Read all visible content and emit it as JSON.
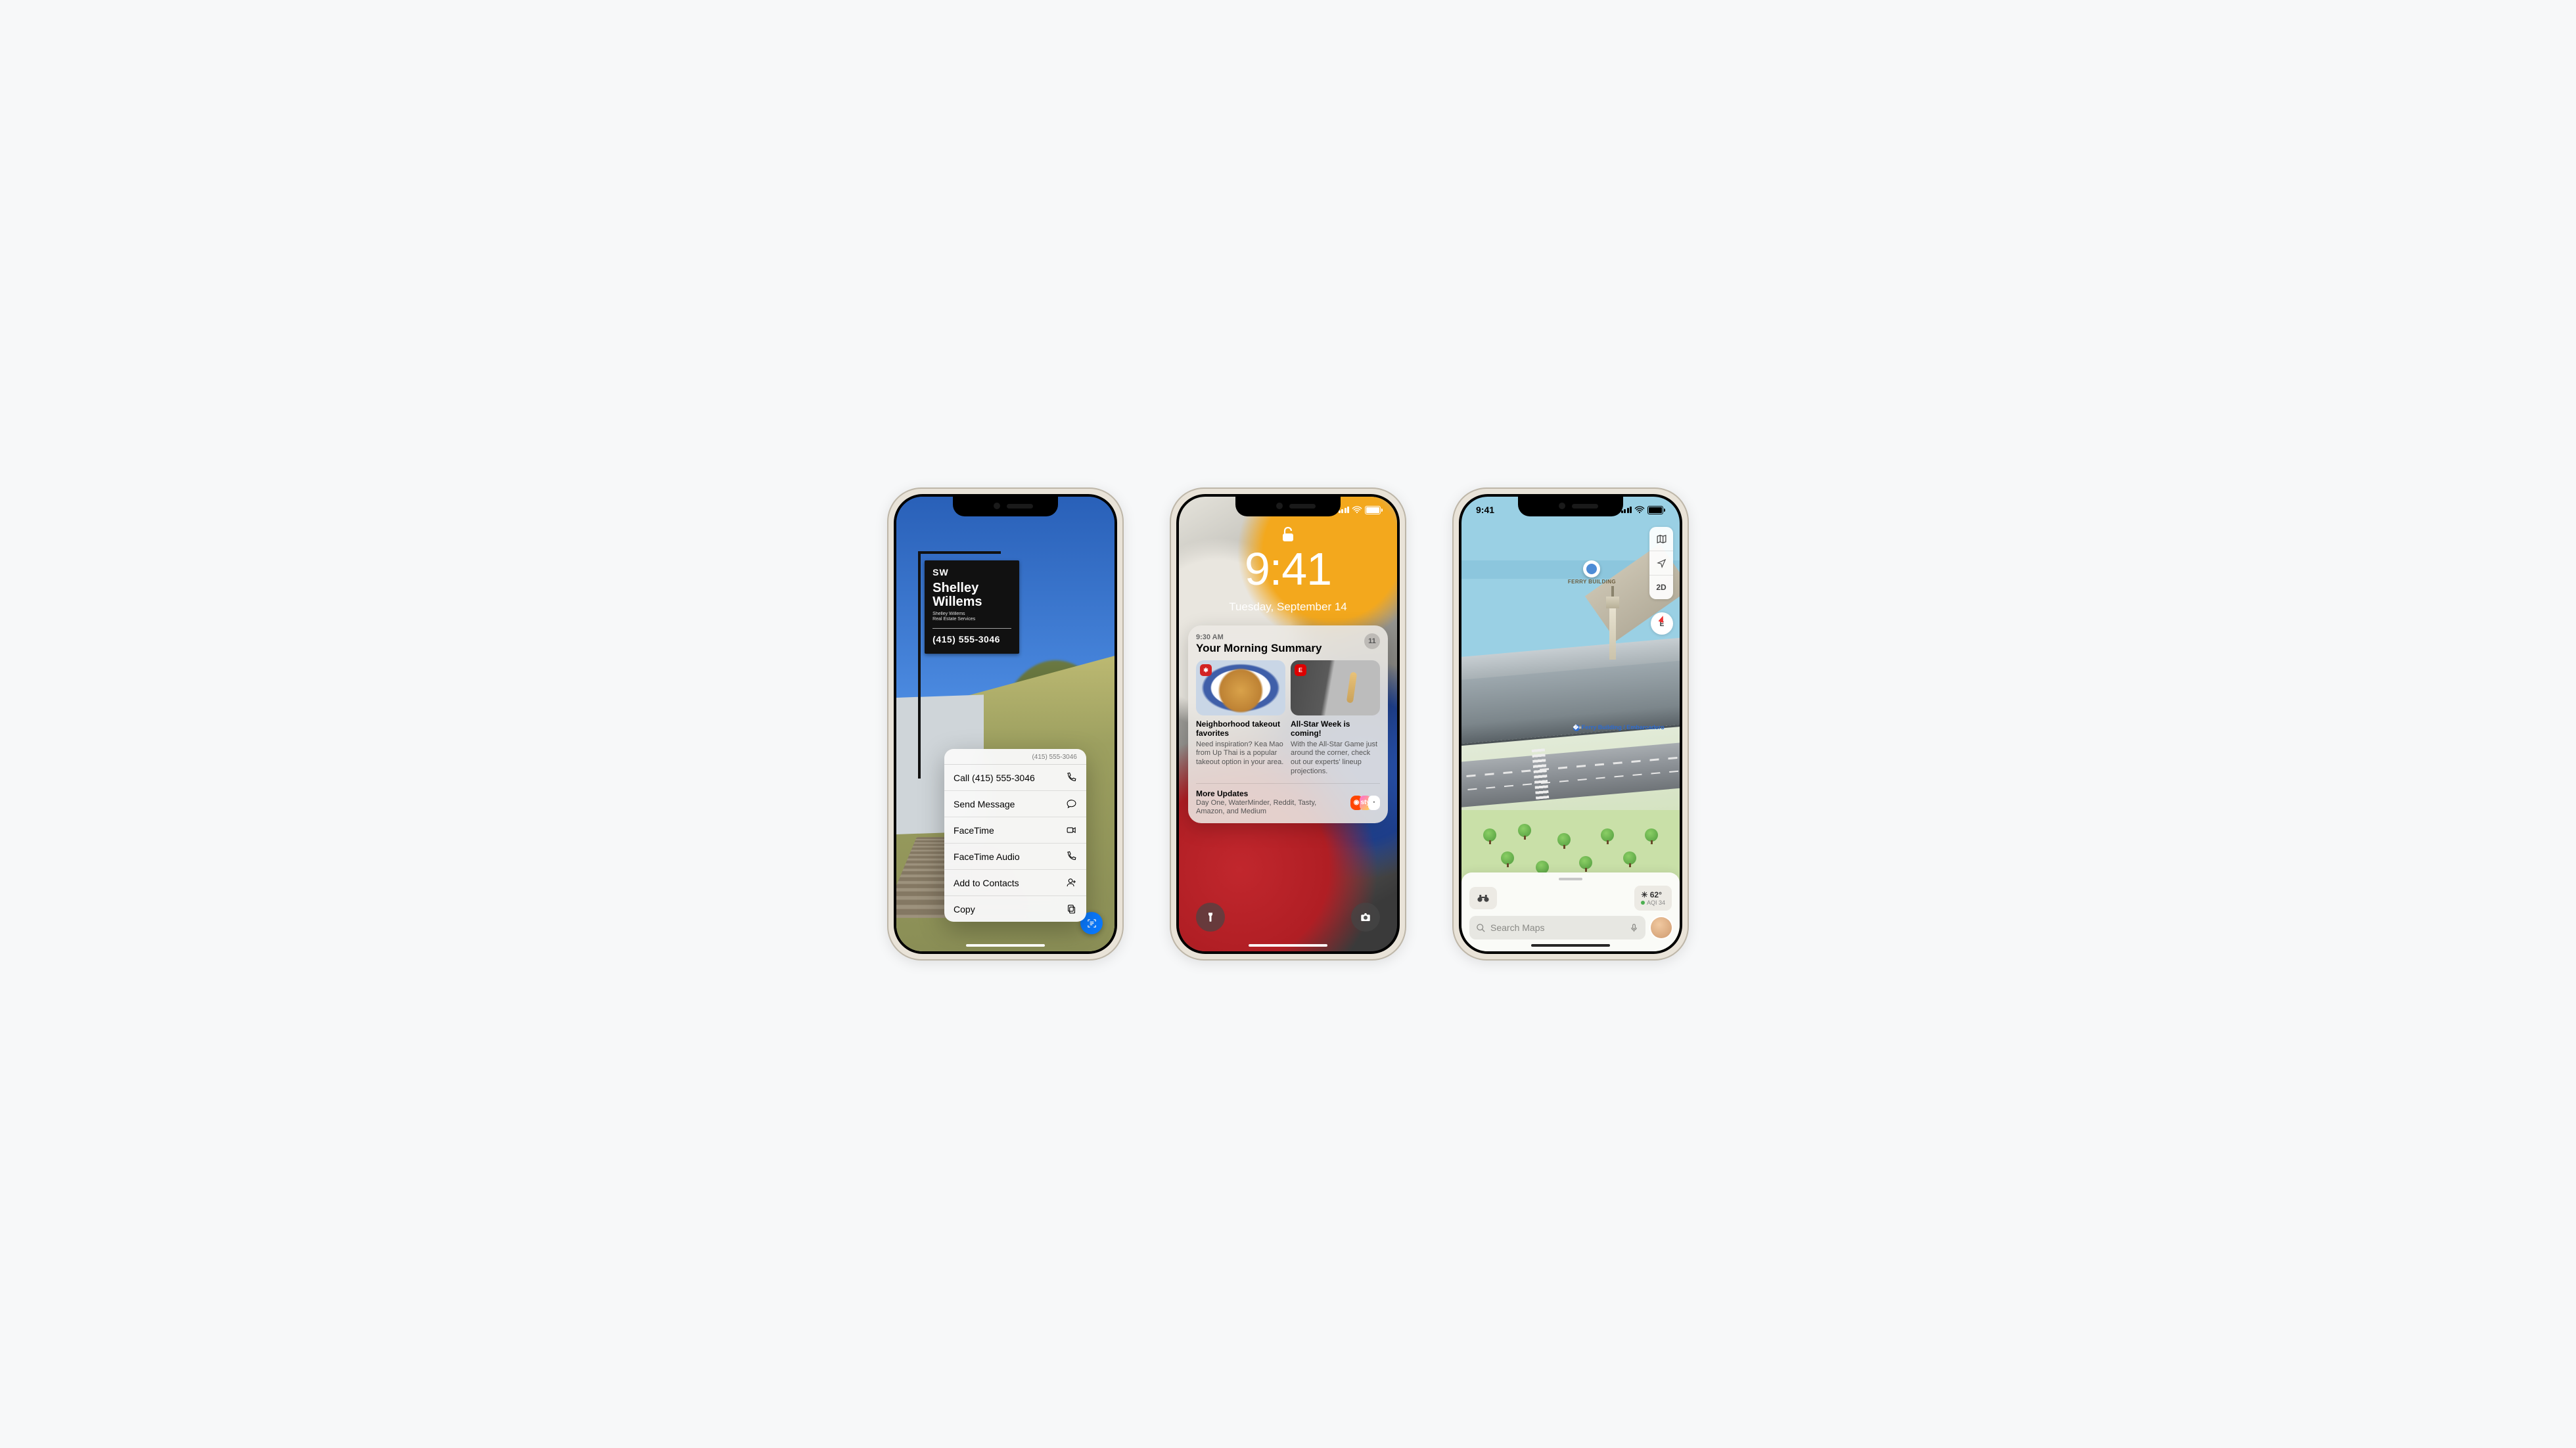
{
  "status_time": "9:41",
  "phone1": {
    "sign": {
      "monogram": "SW",
      "agent_first": "Shelley",
      "agent_last": "Willems",
      "sub1": "Shelley Willems",
      "sub2": "Real Estate Services",
      "phone_display": "(415) 555-3046"
    },
    "menu": {
      "header": "(415) 555-3046",
      "items": [
        {
          "label": "Call (415) 555-3046",
          "icon": "phone"
        },
        {
          "label": "Send Message",
          "icon": "message"
        },
        {
          "label": "FaceTime",
          "icon": "video"
        },
        {
          "label": "FaceTime Audio",
          "icon": "phone"
        },
        {
          "label": "Add to Contacts",
          "icon": "contact-add"
        },
        {
          "label": "Copy",
          "icon": "copy"
        }
      ]
    }
  },
  "phone2": {
    "time": "9:41",
    "date": "Tuesday, September 14",
    "summary": {
      "timestamp": "9:30 AM",
      "title": "Your Morning Summary",
      "count": "11",
      "tiles": [
        {
          "badge": "yelp",
          "headline": "Neighborhood takeout favorites",
          "body": "Need inspiration? Kea Mao from Up Thai is a popular takeout option in your area."
        },
        {
          "badge": "E",
          "headline": "All-Star Week is coming!",
          "body": "With the All-Star Game just around the corner, check out our experts' lineup projections."
        }
      ],
      "more_title": "More Updates",
      "more_body": "Day One, WaterMinder, Reddit, Tasty, Amazon, and Medium"
    }
  },
  "phone3": {
    "poi_name": "FERRY BUILDING",
    "transit_label": "Ferry Building / Embarcadero",
    "controls": {
      "mode2d": "2D"
    },
    "compass": "E",
    "weather": {
      "temp": "62°",
      "aqi_label": "AQI 34"
    },
    "search_placeholder": "Search Maps"
  }
}
